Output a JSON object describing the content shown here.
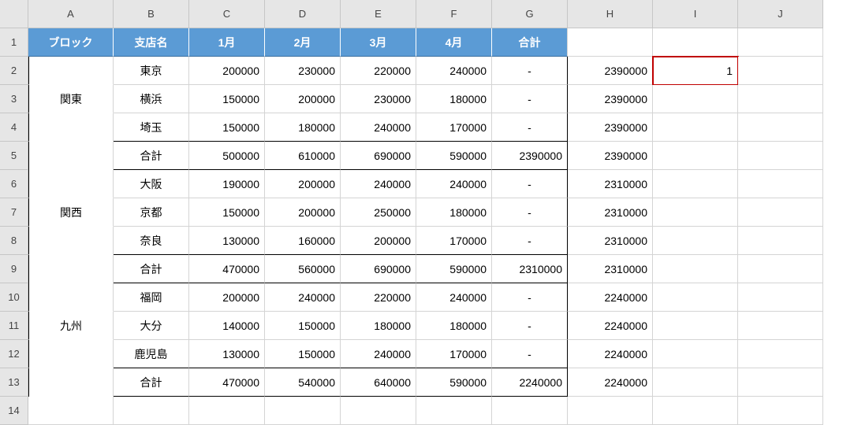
{
  "columns": [
    "A",
    "B",
    "C",
    "D",
    "E",
    "F",
    "G",
    "H",
    "I",
    "J"
  ],
  "rows": [
    "1",
    "2",
    "3",
    "4",
    "5",
    "6",
    "7",
    "8",
    "9",
    "10",
    "11",
    "12",
    "13",
    "14"
  ],
  "header": {
    "block": "ブロック",
    "branch": "支店名",
    "m1": "1月",
    "m2": "2月",
    "m3": "3月",
    "m4": "4月",
    "total": "合計"
  },
  "blocks": [
    {
      "name": "関東",
      "rows": [
        {
          "branch": "東京",
          "m1": "200000",
          "m2": "230000",
          "m3": "220000",
          "m4": "240000",
          "total": "-",
          "h": "2390000",
          "i": "1"
        },
        {
          "branch": "横浜",
          "m1": "150000",
          "m2": "200000",
          "m3": "230000",
          "m4": "180000",
          "total": "-",
          "h": "2390000",
          "i": ""
        },
        {
          "branch": "埼玉",
          "m1": "150000",
          "m2": "180000",
          "m3": "240000",
          "m4": "170000",
          "total": "-",
          "h": "2390000",
          "i": ""
        },
        {
          "branch": "合計",
          "m1": "500000",
          "m2": "610000",
          "m3": "690000",
          "m4": "590000",
          "total": "2390000",
          "h": "2390000",
          "i": ""
        }
      ]
    },
    {
      "name": "関西",
      "rows": [
        {
          "branch": "大阪",
          "m1": "190000",
          "m2": "200000",
          "m3": "240000",
          "m4": "240000",
          "total": "-",
          "h": "2310000",
          "i": ""
        },
        {
          "branch": "京都",
          "m1": "150000",
          "m2": "200000",
          "m3": "250000",
          "m4": "180000",
          "total": "-",
          "h": "2310000",
          "i": ""
        },
        {
          "branch": "奈良",
          "m1": "130000",
          "m2": "160000",
          "m3": "200000",
          "m4": "170000",
          "total": "-",
          "h": "2310000",
          "i": ""
        },
        {
          "branch": "合計",
          "m1": "470000",
          "m2": "560000",
          "m3": "690000",
          "m4": "590000",
          "total": "2310000",
          "h": "2310000",
          "i": ""
        }
      ]
    },
    {
      "name": "九州",
      "rows": [
        {
          "branch": "福岡",
          "m1": "200000",
          "m2": "240000",
          "m3": "220000",
          "m4": "240000",
          "total": "-",
          "h": "2240000",
          "i": ""
        },
        {
          "branch": "大分",
          "m1": "140000",
          "m2": "150000",
          "m3": "180000",
          "m4": "180000",
          "total": "-",
          "h": "2240000",
          "i": ""
        },
        {
          "branch": "鹿児島",
          "m1": "130000",
          "m2": "150000",
          "m3": "240000",
          "m4": "170000",
          "total": "-",
          "h": "2240000",
          "i": ""
        },
        {
          "branch": "合計",
          "m1": "470000",
          "m2": "540000",
          "m3": "640000",
          "m4": "590000",
          "total": "2240000",
          "h": "2240000",
          "i": ""
        }
      ]
    }
  ],
  "selected_cell": {
    "ref": "I2",
    "value": "1"
  },
  "chart_data": {
    "type": "table",
    "title": "",
    "columns": [
      "ブロック",
      "支店名",
      "1月",
      "2月",
      "3月",
      "4月",
      "合計"
    ],
    "rows": [
      [
        "関東",
        "東京",
        200000,
        230000,
        220000,
        240000,
        null
      ],
      [
        "関東",
        "横浜",
        150000,
        200000,
        230000,
        180000,
        null
      ],
      [
        "関東",
        "埼玉",
        150000,
        180000,
        240000,
        170000,
        null
      ],
      [
        "関東",
        "合計",
        500000,
        610000,
        690000,
        590000,
        2390000
      ],
      [
        "関西",
        "大阪",
        190000,
        200000,
        240000,
        240000,
        null
      ],
      [
        "関西",
        "京都",
        150000,
        200000,
        250000,
        180000,
        null
      ],
      [
        "関西",
        "奈良",
        130000,
        160000,
        200000,
        170000,
        null
      ],
      [
        "関西",
        "合計",
        470000,
        560000,
        690000,
        590000,
        2310000
      ],
      [
        "九州",
        "福岡",
        200000,
        240000,
        220000,
        240000,
        null
      ],
      [
        "九州",
        "大分",
        140000,
        150000,
        180000,
        180000,
        null
      ],
      [
        "九州",
        "鹿児島",
        130000,
        150000,
        240000,
        170000,
        null
      ],
      [
        "九州",
        "合計",
        470000,
        540000,
        640000,
        590000,
        2240000
      ]
    ]
  }
}
